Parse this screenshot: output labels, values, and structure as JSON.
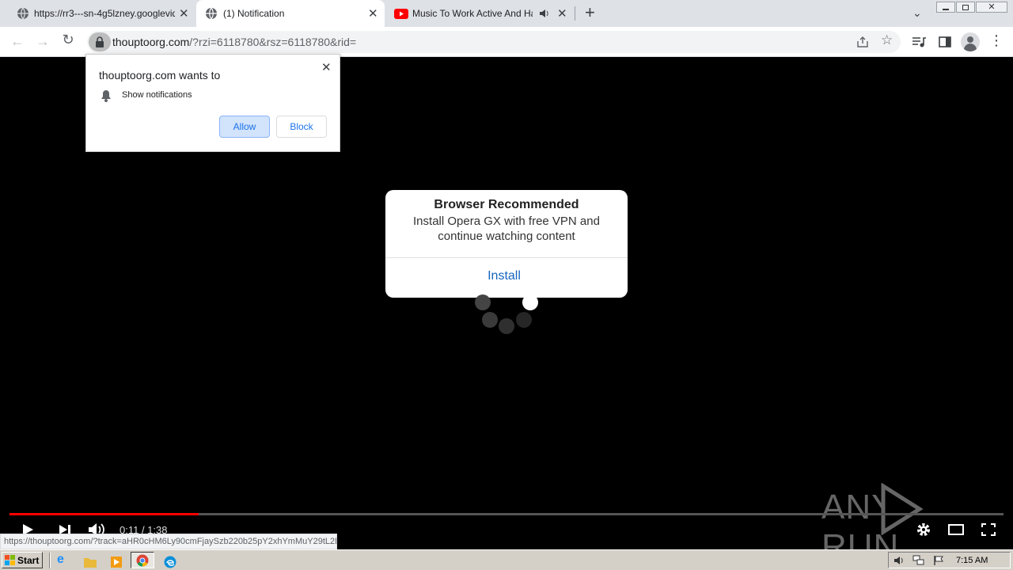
{
  "tabs": [
    {
      "title": "https://rr3---sn-4g5lzney.googlevide",
      "close": "✕"
    },
    {
      "title": "(1) Notification",
      "close": "✕"
    },
    {
      "title": "Music To Work Active And Happy",
      "close": "✕"
    }
  ],
  "new_tab": "+",
  "address": {
    "host": "thouptoorg.com",
    "path": "/?rzi=6118780&rsz=6118780&rid="
  },
  "permission": {
    "title": "thouptoorg.com wants to",
    "item": "Show notifications",
    "allow": "Allow",
    "block": "Block",
    "close": "✕"
  },
  "dialog": {
    "title": "Browser Recommended",
    "line1": "Install Opera GX with free VPN and",
    "line2": "continue watching content",
    "action": "Install"
  },
  "player": {
    "time": "0:11 / 1:38",
    "progress": 0.19
  },
  "watermark": "ANY RUN",
  "status_url": "https://thouptoorg.com/?track=aHR0cHM6Ly90cmFjaySzb220b25pY2xhYmMuY29tL2Fl",
  "taskbar": {
    "start": "Start",
    "clock": "7:15 AM"
  },
  "colors": {
    "accent": "#1a73e8",
    "progress": "#ff0000",
    "install": "#1565c0"
  }
}
